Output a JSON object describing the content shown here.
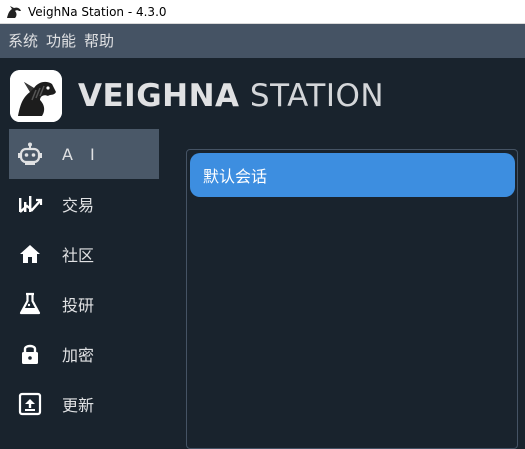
{
  "window": {
    "title": "VeighNa Station - 4.3.0",
    "icon": "horse-logo-icon"
  },
  "menu": [
    "系统",
    "功能",
    "帮助"
  ],
  "brand": {
    "bold": "VEIGHNA",
    "light": " STATION",
    "logo": "horse-logo-icon"
  },
  "sidebar": {
    "items": [
      {
        "label": "A I",
        "icon": "robot-icon",
        "active": true
      },
      {
        "label": "交易",
        "icon": "chart-trade-icon",
        "active": false
      },
      {
        "label": "社区",
        "icon": "home-icon",
        "active": false
      },
      {
        "label": "投研",
        "icon": "flask-icon",
        "active": false
      },
      {
        "label": "加密",
        "icon": "lock-icon",
        "active": false
      },
      {
        "label": "更新",
        "icon": "upload-icon",
        "active": false
      }
    ]
  },
  "main": {
    "sessions": [
      {
        "label": "默认会话"
      }
    ]
  },
  "colors": {
    "background": "#19232d",
    "menubar": "#455364",
    "active_item": "#4a5868",
    "accent": "#3d8ee0",
    "text": "#e0e1e3"
  }
}
